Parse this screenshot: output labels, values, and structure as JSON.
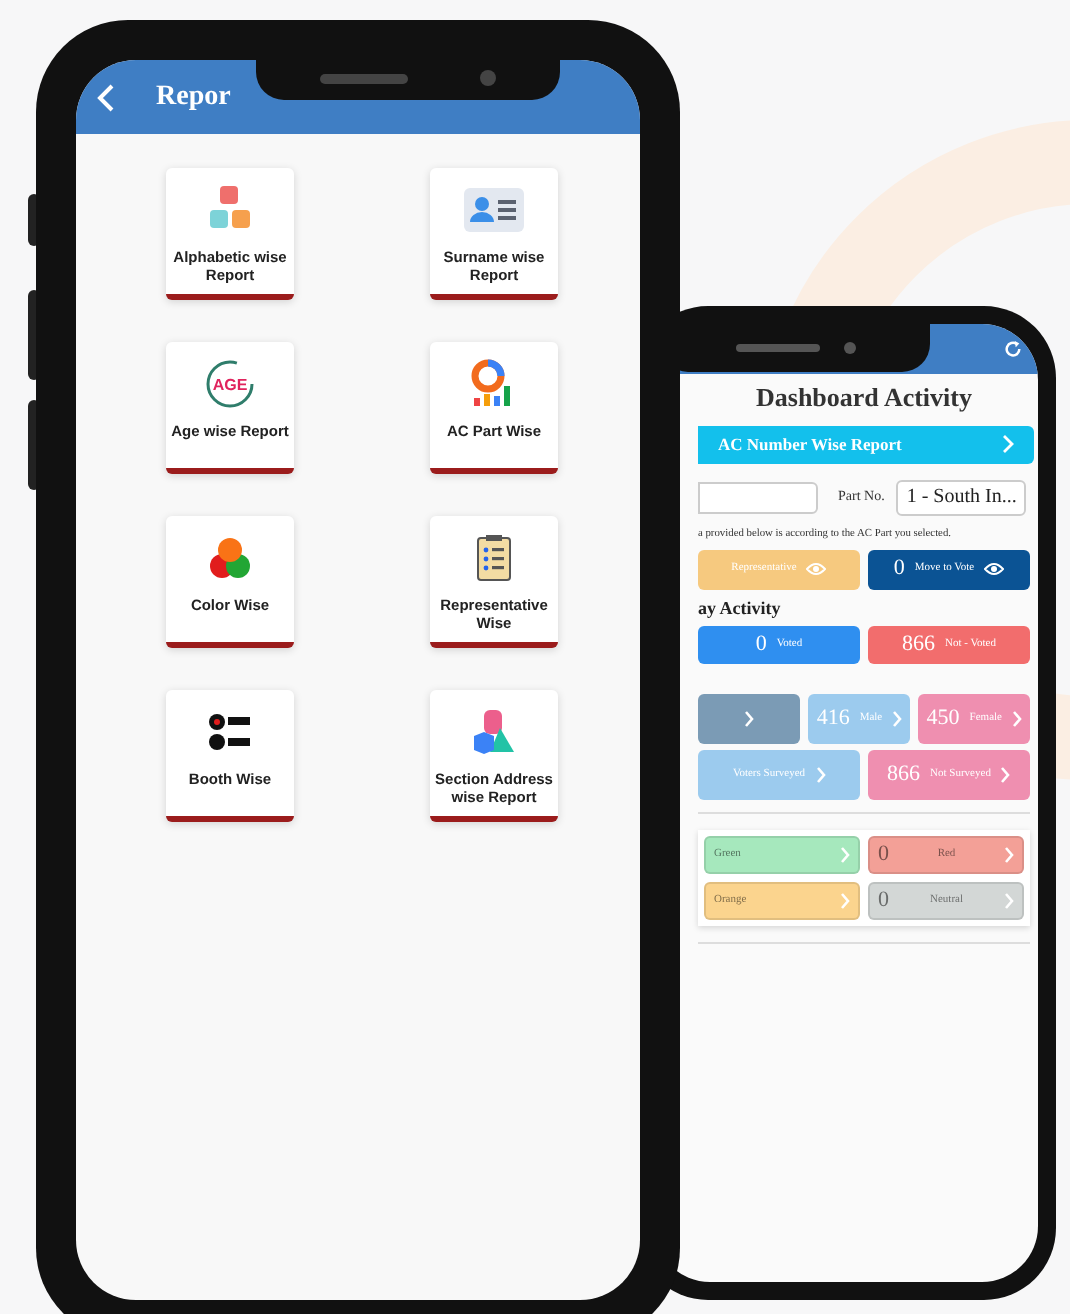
{
  "report_screen": {
    "title": "Repor",
    "tiles": [
      {
        "label": "Alphabetic wise Report"
      },
      {
        "label": "Surname wise Report"
      },
      {
        "label": "Age wise Report",
        "icon_text": "AGE"
      },
      {
        "label": "AC Part Wise"
      },
      {
        "label": "Color Wise"
      },
      {
        "label": "Representative Wise"
      },
      {
        "label": "Booth Wise"
      },
      {
        "label": "Section Address wise Report"
      }
    ]
  },
  "dashboard_screen": {
    "title": "Dashboard Activity",
    "report_link": "AC Number Wise Report",
    "part_label": "Part No.",
    "part_value": "1 - South In...",
    "note": "a provided below is according to the AC Part you selected.",
    "actions": [
      {
        "label": "Representative",
        "color": "#f6c97f"
      },
      {
        "count": "0",
        "label": "Move to Vote",
        "color": "#0b5394"
      }
    ],
    "section_heading": "ay Activity",
    "vote_stats": [
      {
        "count": "0",
        "label": "Voted",
        "color": "#2f8ff0"
      },
      {
        "count": "866",
        "label": "Not - Voted",
        "color": "#f26d6d"
      }
    ],
    "gender_stats": [
      {
        "color": "#7b9bb5"
      },
      {
        "count": "416",
        "label": "Male",
        "color": "#9ccbee"
      },
      {
        "count": "450",
        "label": "Female",
        "color": "#ef8fb0"
      }
    ],
    "survey_stats": [
      {
        "label": "Voters Surveyed",
        "color": "#9ccbee"
      },
      {
        "count": "866",
        "label": "Not Surveyed",
        "color": "#ef8fb0"
      }
    ],
    "color_stats": [
      {
        "label": "Green",
        "color": "#a6e8bd"
      },
      {
        "count": "0",
        "label": "Red",
        "color": "#f3a097"
      },
      {
        "label": "Orange",
        "color": "#fbd48e"
      },
      {
        "count": "0",
        "label": "Neutral",
        "color": "#d3d7d6"
      }
    ]
  }
}
